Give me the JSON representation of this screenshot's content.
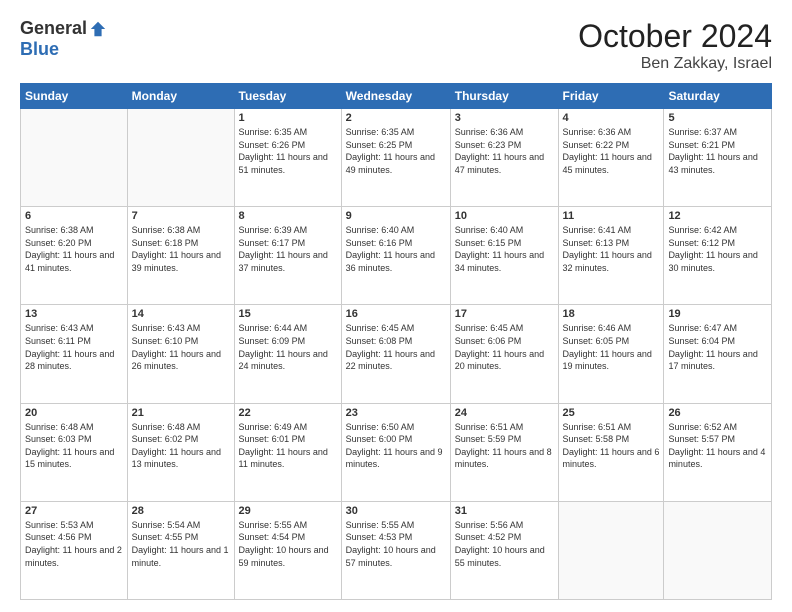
{
  "logo": {
    "general": "General",
    "blue": "Blue"
  },
  "title": "October 2024",
  "location": "Ben Zakkay, Israel",
  "days_header": [
    "Sunday",
    "Monday",
    "Tuesday",
    "Wednesday",
    "Thursday",
    "Friday",
    "Saturday"
  ],
  "weeks": [
    [
      {
        "day": "",
        "sunrise": "",
        "sunset": "",
        "daylight": ""
      },
      {
        "day": "",
        "sunrise": "",
        "sunset": "",
        "daylight": ""
      },
      {
        "day": "1",
        "sunrise": "Sunrise: 6:35 AM",
        "sunset": "Sunset: 6:26 PM",
        "daylight": "Daylight: 11 hours and 51 minutes."
      },
      {
        "day": "2",
        "sunrise": "Sunrise: 6:35 AM",
        "sunset": "Sunset: 6:25 PM",
        "daylight": "Daylight: 11 hours and 49 minutes."
      },
      {
        "day": "3",
        "sunrise": "Sunrise: 6:36 AM",
        "sunset": "Sunset: 6:23 PM",
        "daylight": "Daylight: 11 hours and 47 minutes."
      },
      {
        "day": "4",
        "sunrise": "Sunrise: 6:36 AM",
        "sunset": "Sunset: 6:22 PM",
        "daylight": "Daylight: 11 hours and 45 minutes."
      },
      {
        "day": "5",
        "sunrise": "Sunrise: 6:37 AM",
        "sunset": "Sunset: 6:21 PM",
        "daylight": "Daylight: 11 hours and 43 minutes."
      }
    ],
    [
      {
        "day": "6",
        "sunrise": "Sunrise: 6:38 AM",
        "sunset": "Sunset: 6:20 PM",
        "daylight": "Daylight: 11 hours and 41 minutes."
      },
      {
        "day": "7",
        "sunrise": "Sunrise: 6:38 AM",
        "sunset": "Sunset: 6:18 PM",
        "daylight": "Daylight: 11 hours and 39 minutes."
      },
      {
        "day": "8",
        "sunrise": "Sunrise: 6:39 AM",
        "sunset": "Sunset: 6:17 PM",
        "daylight": "Daylight: 11 hours and 37 minutes."
      },
      {
        "day": "9",
        "sunrise": "Sunrise: 6:40 AM",
        "sunset": "Sunset: 6:16 PM",
        "daylight": "Daylight: 11 hours and 36 minutes."
      },
      {
        "day": "10",
        "sunrise": "Sunrise: 6:40 AM",
        "sunset": "Sunset: 6:15 PM",
        "daylight": "Daylight: 11 hours and 34 minutes."
      },
      {
        "day": "11",
        "sunrise": "Sunrise: 6:41 AM",
        "sunset": "Sunset: 6:13 PM",
        "daylight": "Daylight: 11 hours and 32 minutes."
      },
      {
        "day": "12",
        "sunrise": "Sunrise: 6:42 AM",
        "sunset": "Sunset: 6:12 PM",
        "daylight": "Daylight: 11 hours and 30 minutes."
      }
    ],
    [
      {
        "day": "13",
        "sunrise": "Sunrise: 6:43 AM",
        "sunset": "Sunset: 6:11 PM",
        "daylight": "Daylight: 11 hours and 28 minutes."
      },
      {
        "day": "14",
        "sunrise": "Sunrise: 6:43 AM",
        "sunset": "Sunset: 6:10 PM",
        "daylight": "Daylight: 11 hours and 26 minutes."
      },
      {
        "day": "15",
        "sunrise": "Sunrise: 6:44 AM",
        "sunset": "Sunset: 6:09 PM",
        "daylight": "Daylight: 11 hours and 24 minutes."
      },
      {
        "day": "16",
        "sunrise": "Sunrise: 6:45 AM",
        "sunset": "Sunset: 6:08 PM",
        "daylight": "Daylight: 11 hours and 22 minutes."
      },
      {
        "day": "17",
        "sunrise": "Sunrise: 6:45 AM",
        "sunset": "Sunset: 6:06 PM",
        "daylight": "Daylight: 11 hours and 20 minutes."
      },
      {
        "day": "18",
        "sunrise": "Sunrise: 6:46 AM",
        "sunset": "Sunset: 6:05 PM",
        "daylight": "Daylight: 11 hours and 19 minutes."
      },
      {
        "day": "19",
        "sunrise": "Sunrise: 6:47 AM",
        "sunset": "Sunset: 6:04 PM",
        "daylight": "Daylight: 11 hours and 17 minutes."
      }
    ],
    [
      {
        "day": "20",
        "sunrise": "Sunrise: 6:48 AM",
        "sunset": "Sunset: 6:03 PM",
        "daylight": "Daylight: 11 hours and 15 minutes."
      },
      {
        "day": "21",
        "sunrise": "Sunrise: 6:48 AM",
        "sunset": "Sunset: 6:02 PM",
        "daylight": "Daylight: 11 hours and 13 minutes."
      },
      {
        "day": "22",
        "sunrise": "Sunrise: 6:49 AM",
        "sunset": "Sunset: 6:01 PM",
        "daylight": "Daylight: 11 hours and 11 minutes."
      },
      {
        "day": "23",
        "sunrise": "Sunrise: 6:50 AM",
        "sunset": "Sunset: 6:00 PM",
        "daylight": "Daylight: 11 hours and 9 minutes."
      },
      {
        "day": "24",
        "sunrise": "Sunrise: 6:51 AM",
        "sunset": "Sunset: 5:59 PM",
        "daylight": "Daylight: 11 hours and 8 minutes."
      },
      {
        "day": "25",
        "sunrise": "Sunrise: 6:51 AM",
        "sunset": "Sunset: 5:58 PM",
        "daylight": "Daylight: 11 hours and 6 minutes."
      },
      {
        "day": "26",
        "sunrise": "Sunrise: 6:52 AM",
        "sunset": "Sunset: 5:57 PM",
        "daylight": "Daylight: 11 hours and 4 minutes."
      }
    ],
    [
      {
        "day": "27",
        "sunrise": "Sunrise: 5:53 AM",
        "sunset": "Sunset: 4:56 PM",
        "daylight": "Daylight: 11 hours and 2 minutes."
      },
      {
        "day": "28",
        "sunrise": "Sunrise: 5:54 AM",
        "sunset": "Sunset: 4:55 PM",
        "daylight": "Daylight: 11 hours and 1 minute."
      },
      {
        "day": "29",
        "sunrise": "Sunrise: 5:55 AM",
        "sunset": "Sunset: 4:54 PM",
        "daylight": "Daylight: 10 hours and 59 minutes."
      },
      {
        "day": "30",
        "sunrise": "Sunrise: 5:55 AM",
        "sunset": "Sunset: 4:53 PM",
        "daylight": "Daylight: 10 hours and 57 minutes."
      },
      {
        "day": "31",
        "sunrise": "Sunrise: 5:56 AM",
        "sunset": "Sunset: 4:52 PM",
        "daylight": "Daylight: 10 hours and 55 minutes."
      },
      {
        "day": "",
        "sunrise": "",
        "sunset": "",
        "daylight": ""
      },
      {
        "day": "",
        "sunrise": "",
        "sunset": "",
        "daylight": ""
      }
    ]
  ]
}
